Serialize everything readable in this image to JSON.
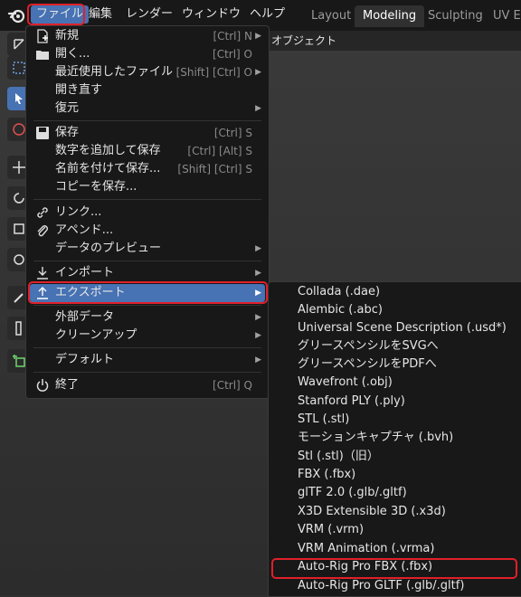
{
  "menubar": {
    "items": [
      "ファイル",
      "編集",
      "レンダー",
      "ウィンドウ",
      "ヘルプ"
    ],
    "workspace_tabs": [
      "Layout",
      "Modeling",
      "Sculpting",
      "UV Ed"
    ],
    "active_tab": "Modeling"
  },
  "viewport_header": {
    "object_menu": "オブジェクト"
  },
  "file_menu": {
    "groups": [
      [
        {
          "label": "新規",
          "shortcut": "[Ctrl] N",
          "icon": "new-file-icon",
          "submenu": true
        },
        {
          "label": "開く...",
          "shortcut": "[Ctrl] O",
          "icon": "folder-icon"
        },
        {
          "label": "最近使用したファイル",
          "shortcut": "[Shift] [Ctrl] O",
          "submenu": true
        },
        {
          "label": "開き直す"
        },
        {
          "label": "復元",
          "submenu": true
        }
      ],
      [
        {
          "label": "保存",
          "shortcut": "[Ctrl] S",
          "icon": "save-icon"
        },
        {
          "label": "数字を追加して保存",
          "shortcut": "[Ctrl] [Alt] S"
        },
        {
          "label": "名前を付けて保存...",
          "shortcut": "[Shift] [Ctrl] S"
        },
        {
          "label": "コピーを保存..."
        }
      ],
      [
        {
          "label": "リンク...",
          "icon": "link-icon"
        },
        {
          "label": "アペンド...",
          "icon": "append-icon"
        },
        {
          "label": "データのプレビュー",
          "submenu": true
        }
      ],
      [
        {
          "label": "インポート",
          "icon": "import-icon",
          "submenu": true
        },
        {
          "label": "エクスポート",
          "icon": "export-icon",
          "submenu": true,
          "highlighted": true
        }
      ],
      [
        {
          "label": "外部データ",
          "submenu": true
        },
        {
          "label": "クリーンアップ",
          "submenu": true
        }
      ],
      [
        {
          "label": "デフォルト",
          "submenu": true
        }
      ],
      [
        {
          "label": "終了",
          "shortcut": "[Ctrl] Q",
          "icon": "power-icon"
        }
      ]
    ]
  },
  "export_menu": {
    "items": [
      "Collada (.dae)",
      "Alembic (.abc)",
      "Universal Scene Description (.usd*)",
      "グリースペンシルをSVGへ",
      "グリースペンシルをPDFへ",
      "Wavefront (.obj)",
      "Stanford PLY (.ply)",
      "STL (.stl)",
      "モーションキャプチャ (.bvh)",
      "Stl (.stl)（旧）",
      "FBX (.fbx)",
      "glTF 2.0 (.glb/.gltf)",
      "X3D Extensible 3D (.x3d)",
      "VRM (.vrm)",
      "VRM Animation (.vrma)",
      "Auto-Rig Pro FBX (.fbx)",
      "Auto-Rig Pro GLTF (.glb/.gltf)"
    ],
    "highlighted": "Auto-Rig Pro FBX (.fbx)"
  },
  "colors": {
    "accent": "#4772b3",
    "annotation": "#e0202a",
    "menu_bg": "#181818"
  }
}
